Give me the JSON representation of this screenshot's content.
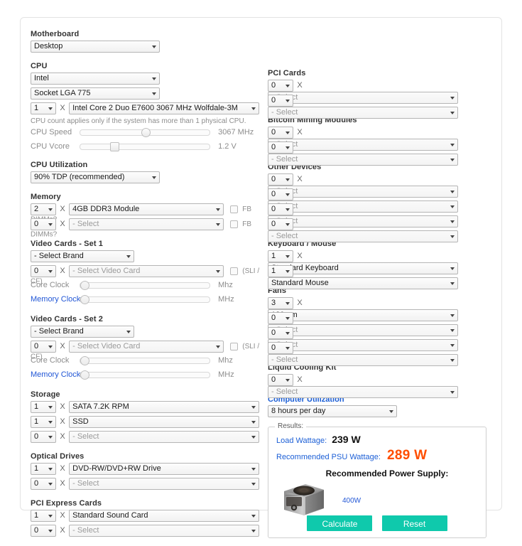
{
  "card": {
    "left_column": {
      "motherboard": {
        "label": "Motherboard",
        "type": {
          "value": "Desktop"
        }
      },
      "cpu": {
        "label": "CPU",
        "brand": {
          "value": "Intel"
        },
        "socket": {
          "value": "Socket LGA 775"
        },
        "count": {
          "value": "1"
        },
        "multiplier": "X",
        "model": {
          "value": "Intel Core 2 Duo E7600 3067 MHz Wolfdale-3M"
        },
        "hint": "CPU count applies only if the system has more than 1 physical CPU.",
        "speed": {
          "label": "CPU Speed",
          "value": "3067 MHz",
          "percent": 47
        },
        "vcore": {
          "label": "CPU Vcore",
          "value": "1.2 V",
          "percent": 23
        }
      },
      "cpu_utilization": {
        "label": "CPU Utilization",
        "value": "90% TDP (recommended)"
      },
      "memory": {
        "label": "Memory",
        "rows": [
          {
            "qty": "2",
            "multiplier": "X",
            "item": "4GB DDR3 Module",
            "checkbox_label": "FB DIMMs?",
            "checked": false,
            "dim": false
          },
          {
            "qty": "0",
            "multiplier": "X",
            "item": "- Select",
            "checkbox_label": "FB DIMMs?",
            "checked": false,
            "dim": true
          }
        ]
      },
      "video_cards_set1": {
        "label": "Video Cards - Set 1",
        "brand": {
          "value": "- Select Brand"
        },
        "card_row": {
          "qty": "0",
          "multiplier": "X",
          "item": "- Select Video Card",
          "checkbox_label": "(SLI / CF)",
          "checked": false,
          "dim": true
        },
        "core_clock": {
          "label": "Core Clock",
          "unit": "Mhz",
          "percent": 0
        },
        "memory_clock": {
          "label": "Memory Clock",
          "unit": "MHz",
          "percent": 0
        }
      },
      "video_cards_set2": {
        "label": "Video Cards - Set 2",
        "brand": {
          "value": "- Select Brand"
        },
        "card_row": {
          "qty": "0",
          "multiplier": "X",
          "item": "- Select Video Card",
          "checkbox_label": "(SLI / CF)",
          "checked": false,
          "dim": true
        },
        "core_clock": {
          "label": "Core Clock",
          "unit": "Mhz",
          "percent": 0
        },
        "memory_clock": {
          "label": "Memory Clock",
          "unit": "MHz",
          "percent": 0
        }
      },
      "storage": {
        "label": "Storage",
        "rows": [
          {
            "qty": "1",
            "multiplier": "X",
            "item": "SATA 7.2K RPM",
            "dim": false
          },
          {
            "qty": "1",
            "multiplier": "X",
            "item": "SSD",
            "dim": false
          },
          {
            "qty": "0",
            "multiplier": "X",
            "item": "- Select",
            "dim": true
          }
        ]
      },
      "optical_drives": {
        "label": "Optical Drives",
        "rows": [
          {
            "qty": "1",
            "multiplier": "X",
            "item": "DVD-RW/DVD+RW Drive",
            "dim": false
          },
          {
            "qty": "0",
            "multiplier": "X",
            "item": "- Select",
            "dim": true
          }
        ]
      },
      "pci_express_cards": {
        "label": "PCI Express Cards",
        "rows": [
          {
            "qty": "1",
            "multiplier": "X",
            "item": "Standard Sound Card",
            "dim": false
          },
          {
            "qty": "0",
            "multiplier": "X",
            "item": "- Select",
            "dim": true
          }
        ]
      }
    },
    "right_column": {
      "pci_cards": {
        "label": "PCI Cards",
        "rows": [
          {
            "qty": "0",
            "multiplier": "X",
            "item": "- Select",
            "dim": true
          },
          {
            "qty": "0",
            "multiplier": "X",
            "item": "- Select",
            "dim": true
          }
        ]
      },
      "bitcoin_mining_modules": {
        "label": "Bitcoin Mining Modules",
        "rows": [
          {
            "qty": "0",
            "multiplier": "X",
            "item": "- Select",
            "dim": true
          },
          {
            "qty": "0",
            "multiplier": "X",
            "item": "- Select",
            "dim": true
          }
        ]
      },
      "other_devices": {
        "label": "Other Devices",
        "rows": [
          {
            "qty": "0",
            "multiplier": "X",
            "item": "- Select",
            "dim": true
          },
          {
            "qty": "0",
            "multiplier": "X",
            "item": "- Select",
            "dim": true
          },
          {
            "qty": "0",
            "multiplier": "X",
            "item": "- Select",
            "dim": true
          },
          {
            "qty": "0",
            "multiplier": "X",
            "item": "- Select",
            "dim": true
          }
        ]
      },
      "keyboard_mouse": {
        "label": "Keyboard / Mouse",
        "rows": [
          {
            "qty": "1",
            "multiplier": "X",
            "item": "Standard Keyboard",
            "dim": false
          },
          {
            "qty": "1",
            "multiplier": "X",
            "item": "Standard Mouse",
            "dim": false
          }
        ]
      },
      "fans": {
        "label": "Fans",
        "rows": [
          {
            "qty": "3",
            "multiplier": "X",
            "item": "120mm",
            "dim": false
          },
          {
            "qty": "0",
            "multiplier": "X",
            "item": "- Select",
            "dim": true
          },
          {
            "qty": "0",
            "multiplier": "X",
            "item": "- Select",
            "dim": true
          },
          {
            "qty": "0",
            "multiplier": "X",
            "item": "- Select",
            "dim": true
          }
        ]
      },
      "liquid_cooling_kit": {
        "label": "Liquid Cooling Kit",
        "rows": [
          {
            "qty": "0",
            "multiplier": "X",
            "item": "- Select",
            "dim": true
          }
        ]
      },
      "computer_utilization": {
        "label": "Computer Utilization",
        "value": "8 hours per day"
      },
      "results": {
        "legend": "Results:",
        "load_wattage_label": "Load Wattage:",
        "load_wattage_value": "239 W",
        "recommended_psu_label": "Recommended PSU Wattage:",
        "recommended_psu_value": "289 W",
        "recommended_supply_title": "Recommended Power Supply:",
        "psu_image_name": "power-supply-unit-photo",
        "psu_caption": "400W",
        "calculate_label": "Calculate",
        "reset_label": "Reset"
      }
    }
  },
  "colors": {
    "accent_blue": "#1c5fd6",
    "accent_orange": "#ff4e00",
    "button_teal": "#0fc9ac",
    "muted_grey": "#8d8d8d"
  }
}
